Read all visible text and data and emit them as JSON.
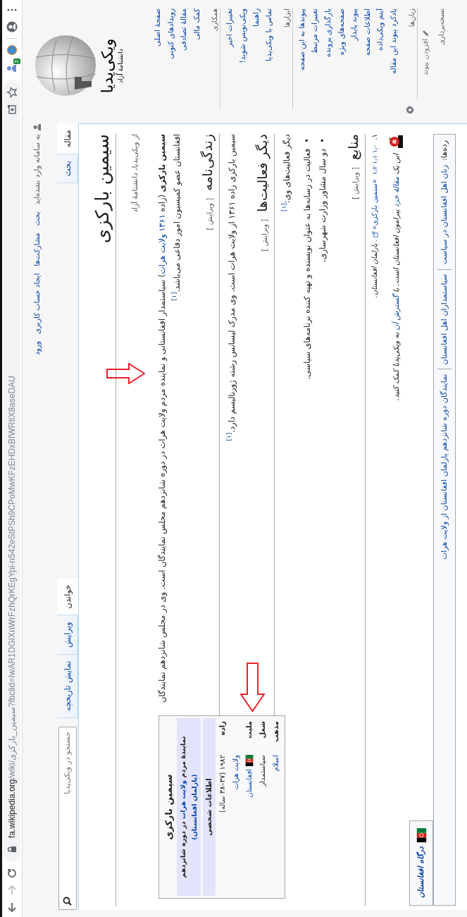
{
  "browser": {
    "url_host": "fa.wikipedia.org",
    "url_rest": "/wiki/سیمین_بارکزی?fbclid=IwAR1DGIXnWrFzhQrKEgYpi-n542eStPSh9CPoMwKFzEHDxBfWRtiX8aseDAU",
    "extension_badge": "2"
  },
  "logo": {
    "wordmark": "ویکی‌پدیا",
    "tagline": "دانشنامهٔ آزاد"
  },
  "sidebar": {
    "navigation": [
      "صفحهٔ اصلی",
      "رویدادهای کنونی",
      "مقالهٔ تصادفی",
      "کمک مالی"
    ],
    "portals": [
      {
        "heading": "همکاری",
        "items": [
          "تغییرات اخیر",
          "ویکی‌نویس شوید!",
          "راهنما",
          "تماس با ویکی‌پدیا"
        ]
      },
      {
        "heading": "ابزارها",
        "items": [
          "پیوندها به این صفحه",
          "تغییرات مرتبط",
          "بارگذاری پرونده",
          "صفحه‌های ویژه",
          "پیوند پایدار",
          "اطلاعات صفحه",
          "آیتم ویکی‌داده",
          "یادکرد پیوند این مقاله"
        ]
      }
    ],
    "languages": {
      "heading": "زبان‌ها",
      "add_link": "افزودن پیوند"
    },
    "print_heading": "نسخه‌برداری"
  },
  "personal_tools": {
    "status": "به سامانه وارد نشده‌اید",
    "links": [
      "بحث",
      "مشارکت‌ها",
      "ایجاد حساب کاربری",
      "ورود"
    ]
  },
  "namespaces": [
    {
      "label": "مقاله",
      "selected": true
    },
    {
      "label": "بحث",
      "selected": false
    }
  ],
  "views": [
    {
      "label": "خواندن",
      "selected": true
    },
    {
      "label": "ویرایش",
      "selected": false
    },
    {
      "label": "نمایش تاریخچه",
      "selected": false
    }
  ],
  "search": {
    "placeholder": "جستجو در ویکی‌پدیا"
  },
  "article": {
    "title": "سیمین بارکزی",
    "tagline": "از ویکی‌پدیا، دانشنامهٔ آزاد",
    "lead": [
      {
        "kind": "bold",
        "text": "سیمین بارکزی"
      },
      {
        "kind": "plain",
        "text": " (زاده "
      },
      {
        "kind": "link",
        "text": "۱۳۶۱"
      },
      {
        "kind": "link",
        "text": "ولایت هرات"
      },
      {
        "kind": "plain",
        "text": ") سیاستمدار افغانستانی و نماینده مردم ولایت هرات در دوره شانزدهم مجلس نمایندگان است. وی در مجلس شانزدهم نمایندگان افغانستان عضو کمیسیون امور دفاعی می‌باشد."
      },
      {
        "kind": "ref",
        "text": "[۱]"
      }
    ],
    "infobox": {
      "title": "سیمین بارکزی",
      "header": [
        {
          "kind": "plain",
          "text": "نمایندهٔ مردم "
        },
        {
          "kind": "link",
          "text": "ولایت هرات"
        },
        {
          "kind": "plain",
          "text": " در دوره شانزدهم "
        },
        {
          "kind": "link",
          "text": "(پارلمان افغانستان)"
        }
      ],
      "section": "اطلاعات شخصی",
      "rows": [
        {
          "label": "زاده",
          "flag": false,
          "values": [
            {
              "kind": "plain",
              "text": "۱۹۸۲ (۳۷–۳۸ ساله)"
            },
            {
              "kind": "link",
              "text": "ولایت هرات"
            }
          ]
        },
        {
          "label": "ملیت",
          "flag": true,
          "values": [
            {
              "kind": "link",
              "text": "افغانستان"
            }
          ]
        },
        {
          "label": "شغل",
          "flag": false,
          "values": [
            {
              "kind": "plain",
              "text": "سیاستمدار"
            }
          ]
        },
        {
          "label": "مذهب",
          "flag": false,
          "values": [
            {
              "kind": "link",
              "text": "اسلام"
            }
          ]
        }
      ]
    },
    "sections": [
      {
        "heading": "زندگی‌نامه",
        "edit": "[ ویرایش ]",
        "blocks": [
          {
            "kind": "paragraph",
            "parts": [
              {
                "kind": "plain",
                "text": "سیمین بارکزی زاده ۱۳۶۱ از ولایت هرات است. وی مدرک لیسانس رشته ژورنالیسم دارد."
              },
              {
                "kind": "ref",
                "text": "[۱]"
              }
            ]
          }
        ]
      },
      {
        "heading": "دیگر فعالیت‌ها",
        "edit": "[ ویرایش ]",
        "blocks": [
          {
            "kind": "paragraph",
            "parts": [
              {
                "kind": "plain",
                "text": "دیگر فعالیت‌های وی:"
              },
              {
                "kind": "ref",
                "text": "[۱]"
              }
            ]
          },
          {
            "kind": "bullets",
            "marker": "•",
            "items": [
              "فعالیت در رسانه‌ها به عنوان نویسنده و تهیه کننده برنامه‌های سیاسی.",
              "دو سال مشاور وزارت شهرسازی."
            ]
          }
        ]
      },
      {
        "heading": "منابع",
        "edit": "[ ویرایش ]",
        "blocks": [
          {
            "kind": "reference",
            "number": "۱.",
            "backlinks": "۱٫۰ ۱٫۱ ۱٫۲",
            "parts": [
              {
                "kind": "link",
                "text": "«سیمین بارکزی»"
              },
              {
                "kind": "italic",
                "text": ". پارلمان افغانستان."
              }
            ]
          }
        ]
      }
    ],
    "stub": [
      {
        "kind": "plain",
        "text": "این یک "
      },
      {
        "kind": "link",
        "text": "مقالهٔ خرد"
      },
      {
        "kind": "plain",
        "text": " پیرامون افغانستان است. با "
      },
      {
        "kind": "link",
        "text": "گسترش آن"
      },
      {
        "kind": "plain",
        "text": " به ویکی‌پدیا کمک کنید."
      }
    ],
    "portal": "درگاه افغانستان",
    "categories": {
      "label": "رده‌ها:",
      "items": [
        "زنان اهل افغانستان در سیاست",
        "سیاستمداران اهل افغانستان",
        "نمایندگان دوره شانزدهم پارلمان افغانستان از ولایت هرات"
      ]
    }
  }
}
